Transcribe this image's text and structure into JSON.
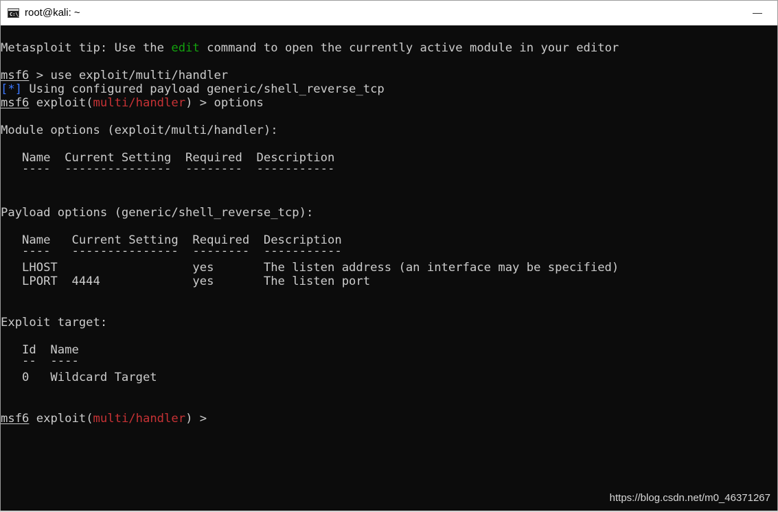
{
  "window": {
    "title": "root@kali: ~",
    "icon_text": "C:\\_"
  },
  "terminal": {
    "tip": {
      "before": "Metasploit tip: Use the ",
      "command": "edit",
      "after": " command to open the currently active module in your editor"
    },
    "prompt1": {
      "msf": "msf6",
      "rest": " > use exploit/multi/handler"
    },
    "info": {
      "tag": "[*]",
      "text": " Using configured payload generic/shell_reverse_tcp"
    },
    "prompt2": {
      "msf": "msf6",
      "pre": " exploit(",
      "module": "multi/handler",
      "post": ") > options"
    },
    "module_options_heading": "Module options (exploit/multi/handler):",
    "module_table_header": "   Name  Current Setting  Required  Description",
    "module_table_rule": "   ----  ---------------  --------  -----------",
    "payload_options_heading": "Payload options (generic/shell_reverse_tcp):",
    "payload_table_header": "   Name   Current Setting  Required  Description",
    "payload_table_rule": "   ----   ---------------  --------  -----------",
    "payload_rows": [
      "   LHOST                   yes       The listen address (an interface may be specified)",
      "   LPORT  4444             yes       The listen port"
    ],
    "exploit_target_heading": "Exploit target:",
    "target_table_header": "   Id  Name",
    "target_table_rule": "   --  ----",
    "target_rows": [
      "   0   Wildcard Target"
    ],
    "prompt3": {
      "msf": "msf6",
      "pre": " exploit(",
      "module": "multi/handler",
      "post": ") > "
    }
  },
  "watermark": "https://blog.csdn.net/m0_46371267",
  "colors": {
    "background": "#0c0c0c",
    "foreground": "#cccccc",
    "green": "#13a10e",
    "red": "#c73235",
    "blue": "#3b78ff"
  }
}
